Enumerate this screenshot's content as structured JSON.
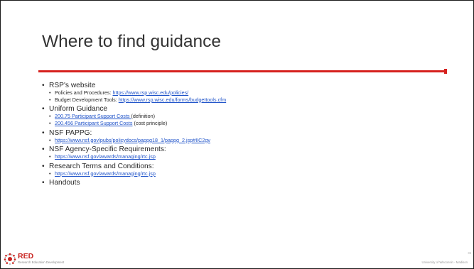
{
  "slide": {
    "title": "Where to find guidance",
    "page_number": "35",
    "footer_right": "University of Wisconsin - Madison",
    "logo": {
      "name": "RED",
      "subtitle": "Research Education Development"
    }
  },
  "bullets": [
    {
      "text": "RSP's website",
      "subs": [
        {
          "prefix": "Policies and Procedures: ",
          "link": "https://www.rsp.wisc.edu/policies/",
          "suffix": ""
        },
        {
          "prefix": "Budget Development Tools: ",
          "link": "https://www.rsp.wisc.edu/forms/budgettools.cfm",
          "suffix": ""
        }
      ]
    },
    {
      "text": "Uniform Guidance",
      "subs": [
        {
          "prefix": "",
          "link": "200.75 Participant Support Costs ",
          "suffix": "(definition)"
        },
        {
          "prefix": "",
          "link": "200.456 Participant Support Costs",
          "suffix": " (cost principle)"
        }
      ]
    },
    {
      "text": "NSF PAPPG:",
      "subs": [
        {
          "prefix": "",
          "link": "https://www.nsf.gov/pubs/policydocs/pappg18_1/pappg_2.jsp#IIC2gv",
          "suffix": ""
        }
      ]
    },
    {
      "text": "NSF Agency-Specific Requirements:",
      "subs": [
        {
          "prefix": "",
          "link": "https://www.nsf.gov/awards/managing/rtc.jsp",
          "suffix": ""
        }
      ]
    },
    {
      "text": "Research Terms and Conditions:",
      "subs": [
        {
          "prefix": "",
          "link": "https://www.nsf.gov/awards/managing/rtc.jsp",
          "suffix": ""
        }
      ]
    },
    {
      "text": "Handouts",
      "subs": []
    }
  ],
  "colors": {
    "accent_rule": "#d6211e",
    "link": "#1f53c9",
    "logo_red": "#c8231f"
  },
  "icons": {
    "logo": "red-starburst-logo-icon"
  }
}
